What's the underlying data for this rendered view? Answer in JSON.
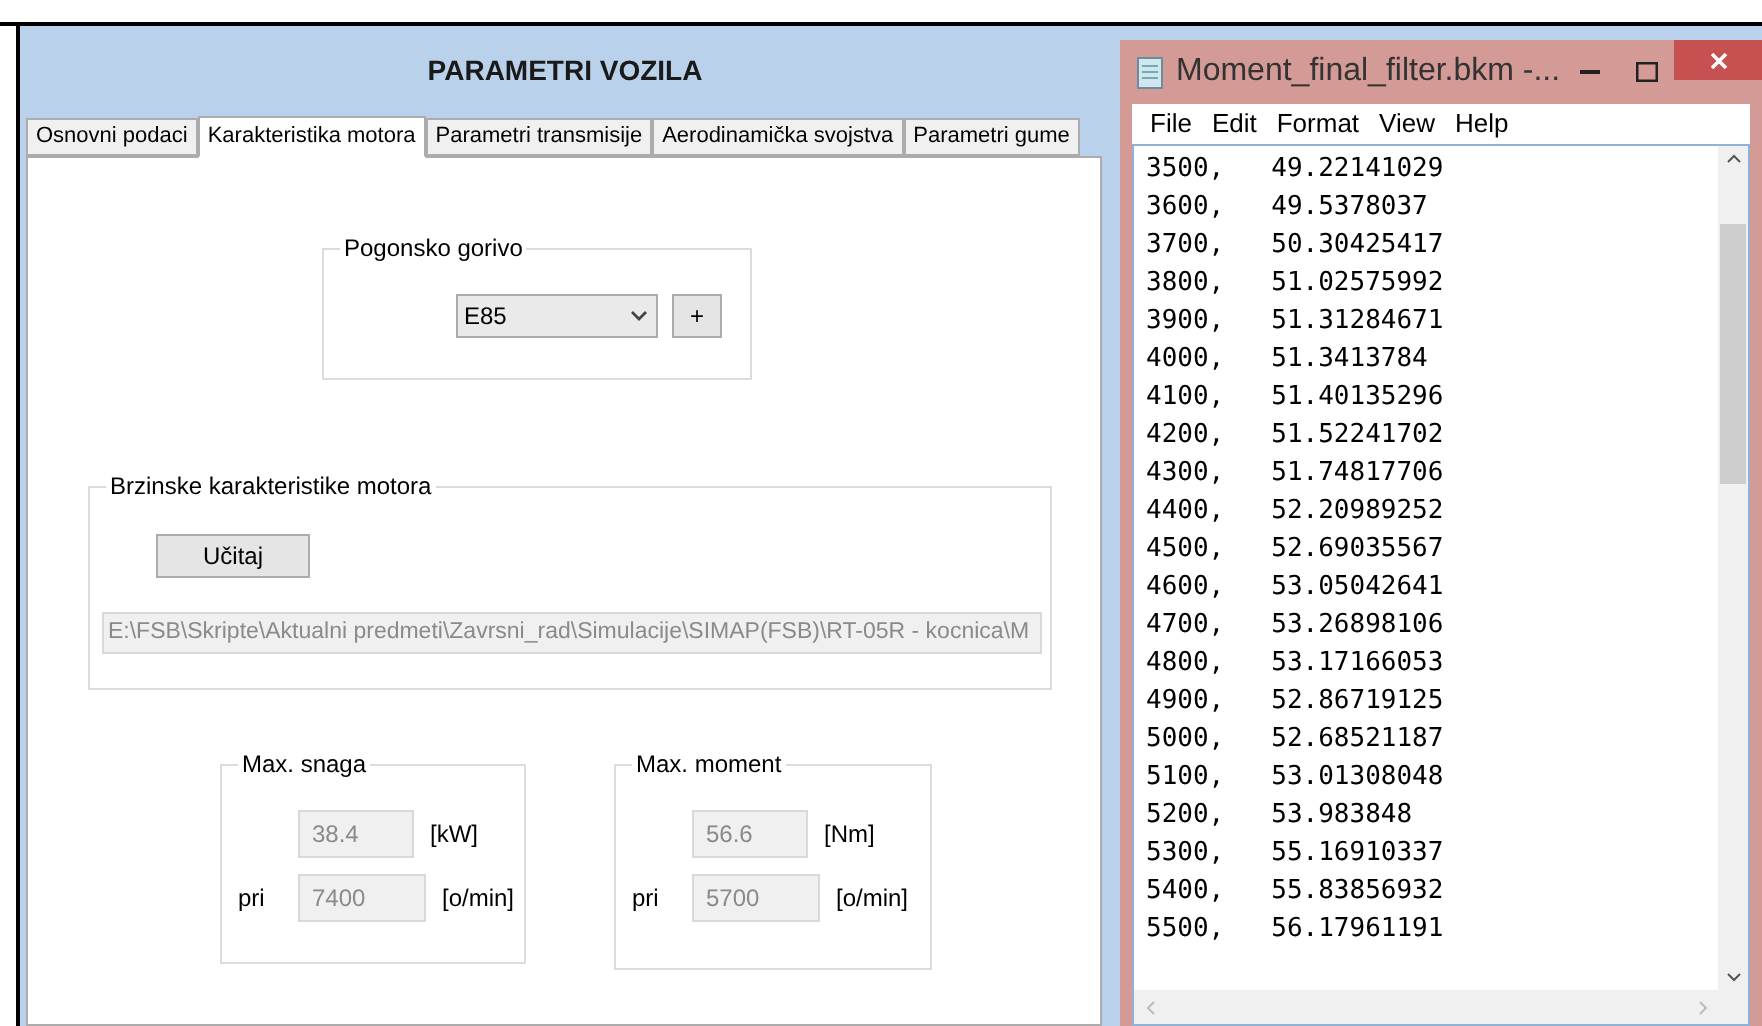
{
  "dialog": {
    "title": "PARAMETRI VOZILA",
    "tabs": [
      {
        "label": "Osnovni podaci",
        "selected": false
      },
      {
        "label": "Karakteristika motora",
        "selected": true
      },
      {
        "label": "Parametri transmisije",
        "selected": false
      },
      {
        "label": "Aerodinamička svojstva",
        "selected": false
      },
      {
        "label": "Parametri gume",
        "selected": false
      }
    ],
    "fuel_group": {
      "legend": "Pogonsko gorivo",
      "fuel": "E85",
      "add_button": "+"
    },
    "speed_group": {
      "legend": "Brzinske karakteristike motora",
      "load_button": "Učitaj",
      "path": "E:\\FSB\\Skripte\\Aktualni predmeti\\Zavrsni_rad\\Simulacije\\SIMAP(FSB)\\RT-05R - kocnica\\M"
    },
    "max_groups": [
      {
        "legend": "Max. snaga",
        "value": "38.4",
        "unit": "[kW]",
        "at_label": "pri",
        "rpm": "7400",
        "rpm_unit": "[o/min]"
      },
      {
        "legend": "Max. moment",
        "value": "56.6",
        "unit": "[Nm]",
        "at_label": "pri",
        "rpm": "5700",
        "rpm_unit": "[o/min]"
      }
    ]
  },
  "notepad": {
    "title": "Moment_final_filter.bkm -...",
    "menu": [
      "File",
      "Edit",
      "Format",
      "View",
      "Help"
    ],
    "lines": [
      "3500,   49.22141029",
      "3600,   49.5378037",
      "3700,   50.30425417",
      "3800,   51.02575992",
      "3900,   51.31284671",
      "4000,   51.3413784",
      "4100,   51.40135296",
      "4200,   51.52241702",
      "4300,   51.74817706",
      "4400,   52.20989252",
      "4500,   52.69035567",
      "4600,   53.05042641",
      "4700,   53.26898106",
      "4800,   53.17166053",
      "4900,   52.86719125",
      "5000,   52.68521187",
      "5100,   53.01308048",
      "5200,   53.983848",
      "5300,   55.16910337",
      "5400,   55.83856932",
      "5500,   56.17961191"
    ]
  }
}
